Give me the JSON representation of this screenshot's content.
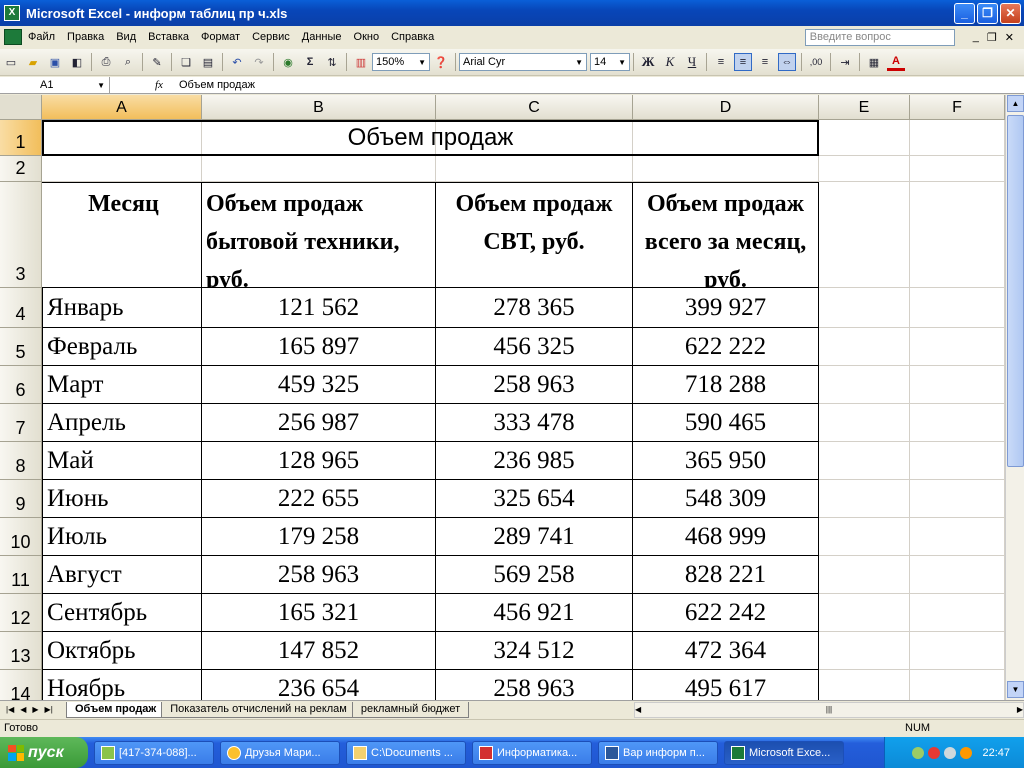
{
  "window": {
    "title": "Microsoft Excel - информ таблиц пр ч.xls"
  },
  "menu": {
    "items": [
      "Файл",
      "Правка",
      "Вид",
      "Вставка",
      "Формат",
      "Сервис",
      "Данные",
      "Окно",
      "Справка"
    ],
    "help_placeholder": "Введите вопрос"
  },
  "toolbar": {
    "zoom": "150%",
    "font": "Arial Cyr",
    "size": "14"
  },
  "formula": {
    "name_box": "A1",
    "fx": "fx",
    "content": "Объем продаж"
  },
  "sheet": {
    "columns": [
      "A",
      "B",
      "C",
      "D",
      "E",
      "F"
    ],
    "rows": [
      "1",
      "2",
      "3",
      "4",
      "5",
      "6",
      "7",
      "8",
      "9",
      "10",
      "11",
      "12",
      "13",
      "14"
    ],
    "title": "Объем продаж",
    "headers": [
      "Месяц",
      "Объем продаж бытовой техники, руб.",
      "Объем продаж СВТ, руб.",
      "Объем продаж всего за месяц, руб."
    ],
    "data": [
      [
        "Январь",
        "121 562",
        "278 365",
        "399 927"
      ],
      [
        "Февраль",
        "165 897",
        "456 325",
        "622 222"
      ],
      [
        "Март",
        "459 325",
        "258 963",
        "718 288"
      ],
      [
        "Апрель",
        "256 987",
        "333 478",
        "590 465"
      ],
      [
        "Май",
        "128 965",
        "236 985",
        "365 950"
      ],
      [
        "Июнь",
        "222 655",
        "325 654",
        "548 309"
      ],
      [
        "Июль",
        "179 258",
        "289 741",
        "468 999"
      ],
      [
        "Август",
        "258 963",
        "569 258",
        "828 221"
      ],
      [
        "Сентябрь",
        "165 321",
        "456 921",
        "622 242"
      ],
      [
        "Октябрь",
        "147 852",
        "324 512",
        "472 364"
      ],
      [
        "Ноябрь",
        "236 654",
        "258 963",
        "495 617"
      ]
    ]
  },
  "tabs": [
    "Объем продаж",
    "Показатель отчислений на реклам",
    "рекламный бюджет"
  ],
  "status": {
    "ready": "Готово",
    "num": "NUM"
  },
  "taskbar": {
    "start": "пуск",
    "tasks": [
      "[417-374-088]...",
      "Друзья Мари...",
      "C:\\Documents ...",
      "Информатика...",
      "Вар информ п...",
      "Microsoft Exce..."
    ],
    "clock": "22:47"
  }
}
